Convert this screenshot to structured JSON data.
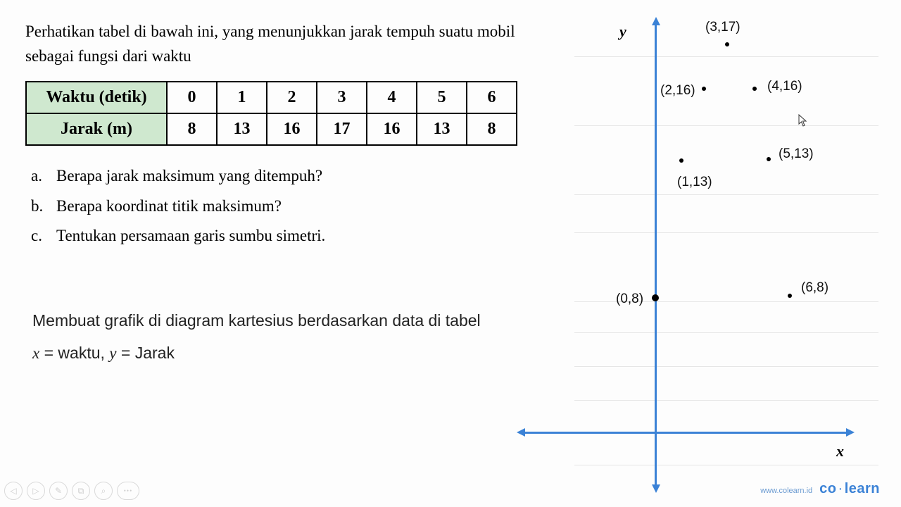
{
  "prompt": "Perhatikan tabel di bawah ini, yang menunjukkan jarak tempuh suatu mobil sebagai fungsi dari waktu",
  "table": {
    "row1_header": "Waktu (detik)",
    "row2_header": "Jarak (m)",
    "waktu": [
      "0",
      "1",
      "2",
      "3",
      "4",
      "5",
      "6"
    ],
    "jarak": [
      "8",
      "13",
      "16",
      "17",
      "16",
      "13",
      "8"
    ]
  },
  "questions": {
    "a": {
      "label": "a.",
      "text": "Berapa jarak maksimum yang ditempuh?"
    },
    "b": {
      "label": "b.",
      "text": "Berapa koordinat titik maksimum?"
    },
    "c": {
      "label": "c.",
      "text": "Tentukan persamaan garis sumbu simetri."
    }
  },
  "solution": {
    "line1": "Membuat grafik di diagram kartesius berdasarkan data di tabel",
    "line2_pre": "x",
    "line2_mid": " = waktu, ",
    "line2_y": "y",
    "line2_post": " = Jarak"
  },
  "axes": {
    "x": "x",
    "y": "y"
  },
  "points": {
    "p0": "(0,8)",
    "p1": "(1,13)",
    "p2": "(2,16)",
    "p3": "(3,17)",
    "p4": "(4,16)",
    "p5": "(5,13)",
    "p6": "(6,8)"
  },
  "footer": {
    "url": "www.colearn.id",
    "logo_a": "co",
    "logo_dot": "·",
    "logo_b": "learn"
  },
  "controls": {
    "prev": "◁",
    "next": "▷",
    "pen": "✎",
    "copy": "⧉",
    "zoom": "⌕",
    "more": "•••"
  },
  "chart_data": {
    "type": "scatter",
    "title": "",
    "xlabel": "x",
    "ylabel": "y",
    "x": [
      0,
      1,
      2,
      3,
      4,
      5,
      6
    ],
    "y": [
      8,
      13,
      16,
      17,
      16,
      13,
      8
    ],
    "point_labels": [
      "(0,8)",
      "(1,13)",
      "(2,16)",
      "(3,17)",
      "(4,16)",
      "(5,13)",
      "(6,8)"
    ],
    "xlim": [
      -6,
      7
    ],
    "ylim": [
      -3,
      30
    ]
  }
}
